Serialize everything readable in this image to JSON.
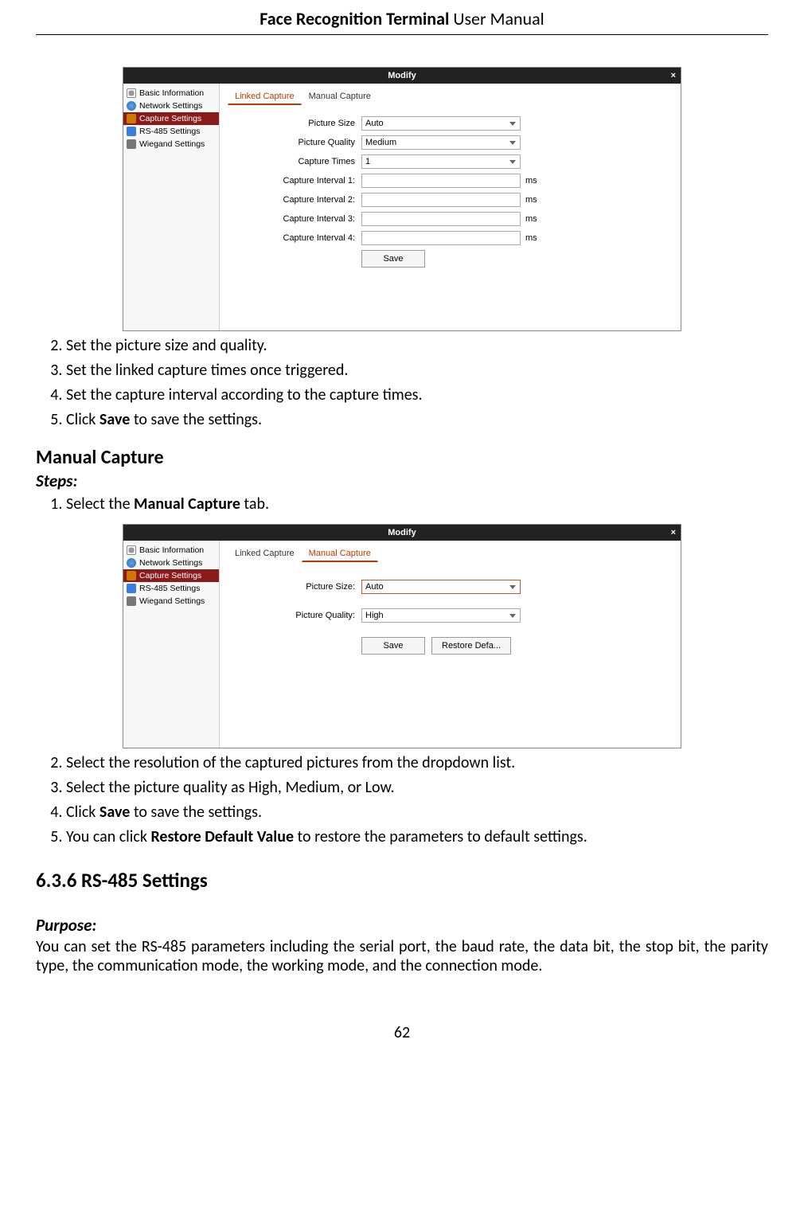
{
  "header": {
    "bold": "Face Recognition Terminal ",
    "plain": " User Manual"
  },
  "dialog1": {
    "title": "Modify",
    "close": "×",
    "sidebar": [
      {
        "label": "Basic Information",
        "icon": "ic-gear"
      },
      {
        "label": "Network Settings",
        "icon": "ic-globe"
      },
      {
        "label": "Capture Settings",
        "icon": "ic-camera",
        "selected": true
      },
      {
        "label": "RS-485 Settings",
        "icon": "ic-rs485"
      },
      {
        "label": "Wiegand Settings",
        "icon": "ic-wieg"
      }
    ],
    "tabs": {
      "active": "Linked Capture",
      "inactive": "Manual Capture"
    },
    "fields": {
      "picture_size": {
        "label": "Picture Size",
        "value": "Auto",
        "type": "select"
      },
      "picture_quality": {
        "label": "Picture Quality",
        "value": "Medium",
        "type": "select"
      },
      "capture_times": {
        "label": "Capture Times",
        "value": "1",
        "type": "select"
      },
      "interval1": {
        "label": "Capture Interval 1:",
        "value": "",
        "unit": "ms"
      },
      "interval2": {
        "label": "Capture Interval 2:",
        "value": "",
        "unit": "ms"
      },
      "interval3": {
        "label": "Capture Interval 3:",
        "value": "",
        "unit": "ms"
      },
      "interval4": {
        "label": "Capture Interval 4:",
        "value": "",
        "unit": "ms"
      }
    },
    "save_label": "Save"
  },
  "list_a": {
    "i2": "Set the picture size and quality.",
    "i3": "Set the linked capture times once triggered.",
    "i4": "Set the capture interval according to the capture times.",
    "i5a": "Click ",
    "i5b": "Save",
    "i5c": " to save the settings."
  },
  "h_manual": "Manual Capture",
  "steps_label": "Steps:",
  "step1a": "Select the ",
  "step1b": "Manual Capture",
  "step1c": " tab.",
  "dialog2": {
    "title": "Modify",
    "close": "×",
    "sidebar": [
      {
        "label": "Basic Information",
        "icon": "ic-gear"
      },
      {
        "label": "Network Settings",
        "icon": "ic-globe"
      },
      {
        "label": "Capture Settings",
        "icon": "ic-camera",
        "selected": true
      },
      {
        "label": "RS-485 Settings",
        "icon": "ic-rs485"
      },
      {
        "label": "Wiegand Settings",
        "icon": "ic-wieg"
      }
    ],
    "tabs": {
      "inactive": "Linked Capture",
      "active": "Manual Capture"
    },
    "fields": {
      "picture_size": {
        "label": "Picture Size:",
        "value": "Auto",
        "type": "select"
      },
      "picture_quality": {
        "label": "Picture Quality:",
        "value": "High",
        "type": "select"
      }
    },
    "save_label": "Save",
    "restore_label": "Restore Defa..."
  },
  "list_b": {
    "i2": "Select the resolution of the captured pictures from the dropdown list.",
    "i3": "Select the picture quality as High, Medium, or Low.",
    "i4a": "Click ",
    "i4b": "Save",
    "i4c": " to save the settings.",
    "i5a": "You can click ",
    "i5b": "Restore Default Value",
    "i5c": " to restore the parameters to default settings."
  },
  "h_636": "6.3.6   RS-485 Settings",
  "purpose_label": "Purpose:",
  "purpose_text": "You can set the RS-485 parameters including the serial port, the baud rate, the data bit, the stop bit, the parity type, the communication mode, the working mode, and the connection mode.",
  "page_number": "62"
}
